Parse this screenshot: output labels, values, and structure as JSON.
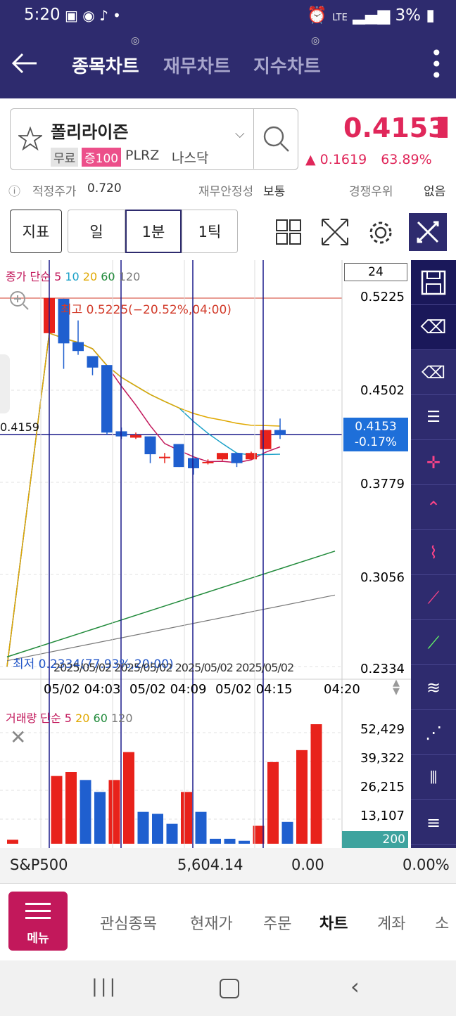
{
  "status": {
    "time": "5:20",
    "battery": "3%",
    "network": "LTE"
  },
  "tabs": [
    "종목차트",
    "재무차트",
    "지수차트"
  ],
  "stock": {
    "name": "폴리라이즌",
    "tags": [
      "무료",
      "증100"
    ],
    "ticker": "PLRZ",
    "market": "나스닥",
    "price": "0.4153",
    "change": "0.1619",
    "change_pct": "63.89%"
  },
  "info": {
    "fair_label": "적정주가",
    "fair_value": "0.720",
    "fin_label": "재무안정성",
    "fin_value": "보통",
    "comp_label": "경쟁우위",
    "comp_value": "없음"
  },
  "toolbar": {
    "indicator": "지표",
    "day": "일",
    "min": "1분",
    "tick": "1틱"
  },
  "chart": {
    "count_box": "24",
    "ma_legend": {
      "title": "종가 단순",
      "periods": [
        "5",
        "10",
        "20",
        "60",
        "120"
      ]
    },
    "vol_legend": {
      "title": "거래량 단순",
      "periods": [
        "5",
        "20",
        "60",
        "120"
      ]
    },
    "price_axis": [
      "0.5225",
      "0.4502",
      "0.3779",
      "0.3056",
      "0.2334"
    ],
    "current_price": "0.4153",
    "current_pct": "-0.17%",
    "crosshair_price": "0.4159",
    "high_label": "최고 0.5225(−20.52%,04:00)",
    "low_label": "최저 0.2334(77.93%,20:00)",
    "time_labels": [
      "05/02 04:03",
      "05/02 04:09",
      "05/02 04:15",
      "04:20"
    ],
    "overlap_label": "2025/05/02 2025/05/02 2025/05/02 2025/05/02",
    "vol_axis": [
      "52,429",
      "39,322",
      "26,215",
      "13,107"
    ],
    "vol_current": "200"
  },
  "chart_data": {
    "type": "candlestick",
    "ylim": [
      0.2334,
      0.5225
    ],
    "candles": [
      {
        "o": 0.5225,
        "c": 0.495,
        "h": 0.5225,
        "l": 0.495,
        "up": true
      },
      {
        "o": 0.522,
        "c": 0.487,
        "h": 0.522,
        "l": 0.467,
        "up": false
      },
      {
        "o": 0.488,
        "c": 0.481,
        "h": 0.505,
        "l": 0.478,
        "up": false
      },
      {
        "o": 0.477,
        "c": 0.468,
        "h": 0.477,
        "l": 0.462,
        "up": false
      },
      {
        "o": 0.47,
        "c": 0.417,
        "h": 0.47,
        "l": 0.415,
        "up": false
      },
      {
        "o": 0.418,
        "c": 0.414,
        "h": 0.421,
        "l": 0.412,
        "up": false
      },
      {
        "o": 0.415,
        "c": 0.413,
        "h": 0.417,
        "l": 0.412,
        "up": true
      },
      {
        "o": 0.414,
        "c": 0.4,
        "h": 0.414,
        "l": 0.393,
        "up": false
      },
      {
        "o": 0.397,
        "c": 0.398,
        "h": 0.401,
        "l": 0.393,
        "up": true
      },
      {
        "o": 0.408,
        "c": 0.39,
        "h": 0.408,
        "l": 0.39,
        "up": false
      },
      {
        "o": 0.397,
        "c": 0.389,
        "h": 0.397,
        "l": 0.384,
        "up": false
      },
      {
        "o": 0.393,
        "c": 0.394,
        "h": 0.396,
        "l": 0.392,
        "up": true
      },
      {
        "o": 0.396,
        "c": 0.401,
        "h": 0.401,
        "l": 0.395,
        "up": true
      },
      {
        "o": 0.401,
        "c": 0.393,
        "h": 0.401,
        "l": 0.39,
        "up": false
      },
      {
        "o": 0.396,
        "c": 0.401,
        "h": 0.402,
        "l": 0.396,
        "up": true
      },
      {
        "o": 0.404,
        "c": 0.419,
        "h": 0.419,
        "l": 0.404,
        "up": true
      },
      {
        "o": 0.419,
        "c": 0.415,
        "h": 0.428,
        "l": 0.412,
        "up": false
      }
    ],
    "volume": [
      {
        "v": 2000,
        "up": true
      },
      {
        "v": 34000,
        "up": true
      },
      {
        "v": 36000,
        "up": true
      },
      {
        "v": 32000,
        "up": false
      },
      {
        "v": 26000,
        "up": false
      },
      {
        "v": 32000,
        "up": true
      },
      {
        "v": 46000,
        "up": true
      },
      {
        "v": 16000,
        "up": false
      },
      {
        "v": 15000,
        "up": false
      },
      {
        "v": 10000,
        "up": false
      },
      {
        "v": 26000,
        "up": true
      },
      {
        "v": 16000,
        "up": false
      },
      {
        "v": 2500,
        "up": false
      },
      {
        "v": 2500,
        "up": false
      },
      {
        "v": 1500,
        "up": false
      },
      {
        "v": 9000,
        "up": true
      },
      {
        "v": 41000,
        "up": true
      },
      {
        "v": 11000,
        "up": false
      },
      {
        "v": 47000,
        "up": true
      },
      {
        "v": 60000,
        "up": true
      }
    ],
    "vol_max": 60000
  },
  "index": {
    "name": "S&P500",
    "value": "5,604.14",
    "change": "0.00",
    "pct": "0.00%"
  },
  "nav": {
    "menu": "메뉴",
    "items": [
      "관심종목",
      "현재가",
      "주문",
      "차트",
      "계좌",
      "소"
    ]
  }
}
